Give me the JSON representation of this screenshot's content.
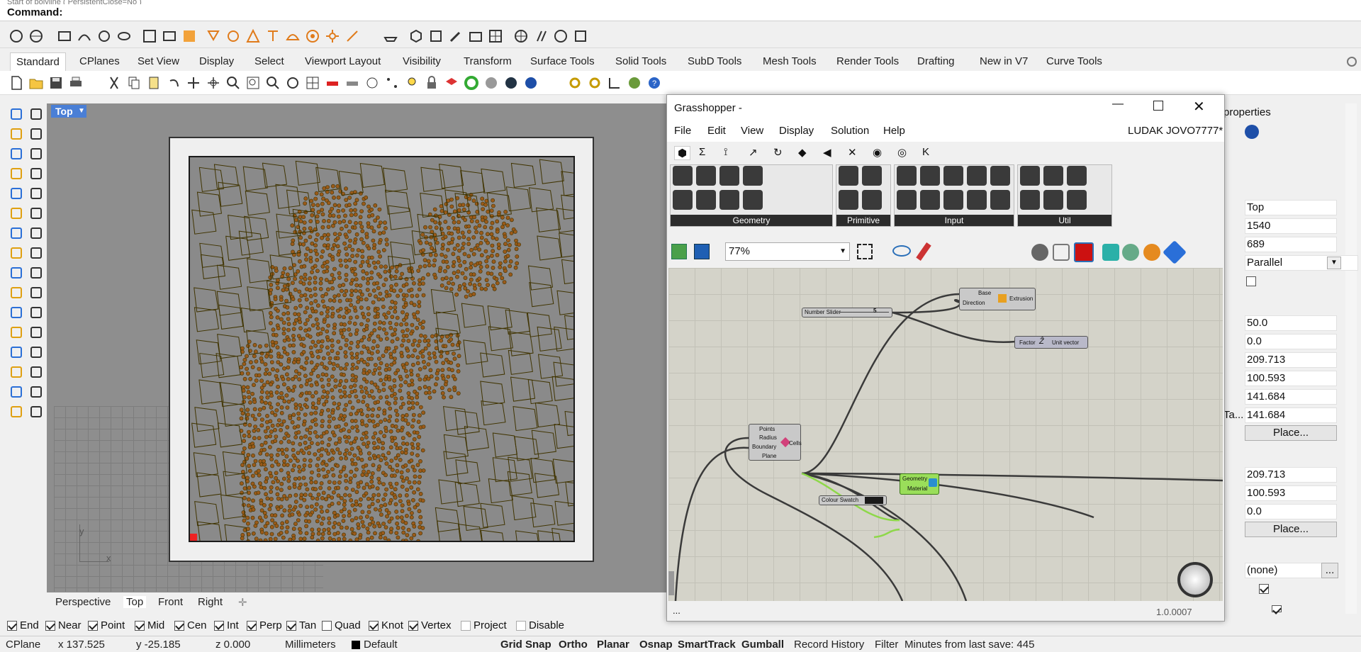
{
  "history": {
    "text": "Start of polyline ( PersistentClose=No )"
  },
  "command": {
    "label": "Command:",
    "value": ""
  },
  "tabs": [
    "Standard",
    "CPlanes",
    "Set View",
    "Display",
    "Select",
    "Viewport Layout",
    "Visibility",
    "Transform",
    "Surface Tools",
    "Solid Tools",
    "SubD Tools",
    "Mesh Tools",
    "Render Tools",
    "Drafting",
    "New in V7",
    "Curve Tools"
  ],
  "viewport": {
    "name": "Top",
    "axis_y": "y",
    "axis_x": "x"
  },
  "viewport_tabs": [
    "Perspective",
    "Top",
    "Front",
    "Right"
  ],
  "osnaps": [
    {
      "label": "End",
      "checked": true
    },
    {
      "label": "Near",
      "checked": true
    },
    {
      "label": "Point",
      "checked": true
    },
    {
      "label": "Mid",
      "checked": true
    },
    {
      "label": "Cen",
      "checked": true
    },
    {
      "label": "Int",
      "checked": true
    },
    {
      "label": "Perp",
      "checked": true
    },
    {
      "label": "Tan",
      "checked": true
    },
    {
      "label": "Quad",
      "checked": false
    },
    {
      "label": "Knot",
      "checked": true
    },
    {
      "label": "Vertex",
      "checked": true
    },
    {
      "label": "Project",
      "checked": false
    },
    {
      "label": "Disable",
      "checked": false
    }
  ],
  "status": {
    "cplane": "CPlane",
    "x": "x 137.525",
    "y": "y -25.185",
    "z": "z 0.000",
    "units": "Millimeters",
    "layer": "Default",
    "toggles": [
      "Grid Snap",
      "Ortho",
      "Planar",
      "Osnap",
      "SmartTrack",
      "Gumball"
    ],
    "record": "Record History",
    "filter": "Filter",
    "minutes": "Minutes from last save: 445"
  },
  "properties": {
    "title": "properties",
    "values": [
      "Top",
      "1540",
      "689",
      "Parallel",
      "50.0",
      "0.0",
      "209.713",
      "100.593",
      "141.684",
      "141.684",
      "209.713",
      "100.593",
      "0.0",
      "(none)"
    ],
    "place": "Place...",
    "browse": "...",
    "trunc_label": "Ta..."
  },
  "grasshopper": {
    "title": "Grasshopper -",
    "menu": [
      "File",
      "Edit",
      "View",
      "Display",
      "Solution",
      "Help"
    ],
    "doc": "LUDAK JOVO7777*",
    "tab_glyphs": [
      "⬢",
      "Σ",
      "⟟",
      "↗",
      "↻",
      "◆",
      "◀",
      "✕",
      "◉",
      "◎",
      "K"
    ],
    "groups": [
      "Geometry",
      "Primitive",
      "Input",
      "Util"
    ],
    "zoom": "77%",
    "nodes": {
      "slider_label": "Number Slider",
      "slider_value": "5",
      "extrusion_in": [
        "Base",
        "Direction"
      ],
      "extrusion_out": "Extrusion",
      "unit_in": "Factor",
      "unit_out": "Unit vector",
      "voronoi_in": [
        "Points",
        "Radius",
        "Boundary",
        "Plane"
      ],
      "voronoi_out": "Cells",
      "swatch": "Colour Swatch",
      "preview_in": [
        "Geometry",
        "Material"
      ]
    },
    "status_left": "...",
    "version": "1.0.0007"
  },
  "colors": {
    "accent": "#4a7fd6",
    "cell_fill": "#9a5a1a",
    "line": "#403400",
    "canvas": "#d4d3c9",
    "node_green": "#9ade5a"
  }
}
